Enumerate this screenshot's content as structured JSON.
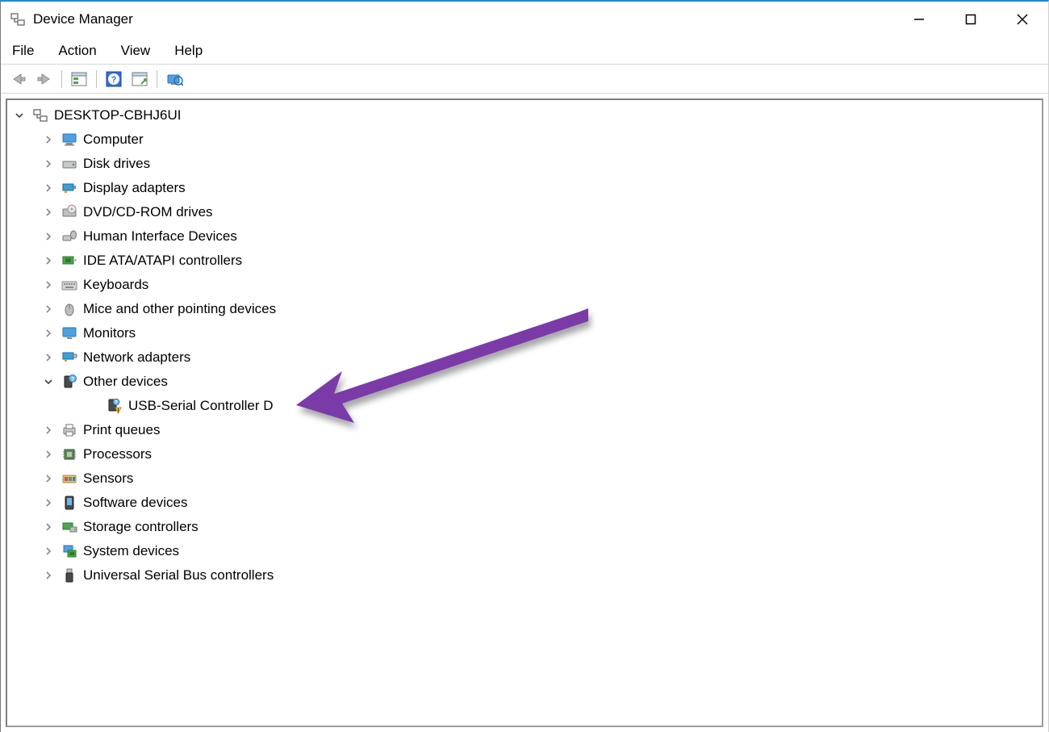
{
  "window": {
    "title": "Device Manager"
  },
  "menu": {
    "file": "File",
    "action": "Action",
    "view": "View",
    "help": "Help"
  },
  "toolbar": {
    "back": "back",
    "forward": "forward",
    "show_hidden": "show-hidden",
    "help": "help",
    "properties": "properties",
    "scan": "scan"
  },
  "tree": {
    "root": "DESKTOP-CBHJ6UI",
    "items": [
      {
        "label": "Computer",
        "icon": "computer",
        "expanded": false
      },
      {
        "label": "Disk drives",
        "icon": "disk",
        "expanded": false
      },
      {
        "label": "Display adapters",
        "icon": "display",
        "expanded": false
      },
      {
        "label": "DVD/CD-ROM drives",
        "icon": "dvd",
        "expanded": false
      },
      {
        "label": "Human Interface Devices",
        "icon": "hid",
        "expanded": false
      },
      {
        "label": "IDE ATA/ATAPI controllers",
        "icon": "ide",
        "expanded": false
      },
      {
        "label": "Keyboards",
        "icon": "keyboard",
        "expanded": false
      },
      {
        "label": "Mice and other pointing devices",
        "icon": "mouse",
        "expanded": false
      },
      {
        "label": "Monitors",
        "icon": "monitor",
        "expanded": false
      },
      {
        "label": "Network adapters",
        "icon": "network",
        "expanded": false
      },
      {
        "label": "Other devices",
        "icon": "other",
        "expanded": true,
        "children": [
          {
            "label": "USB-Serial Controller D",
            "icon": "warning-device"
          }
        ]
      },
      {
        "label": "Print queues",
        "icon": "printer",
        "expanded": false
      },
      {
        "label": "Processors",
        "icon": "processor",
        "expanded": false
      },
      {
        "label": "Sensors",
        "icon": "sensor",
        "expanded": false
      },
      {
        "label": "Software devices",
        "icon": "software",
        "expanded": false
      },
      {
        "label": "Storage controllers",
        "icon": "storage",
        "expanded": false
      },
      {
        "label": "System devices",
        "icon": "system",
        "expanded": false
      },
      {
        "label": "Universal Serial Bus controllers",
        "icon": "usb",
        "expanded": false
      }
    ]
  },
  "annotation": {
    "arrow_color": "#7a3aa8",
    "target": "USB-Serial Controller D"
  }
}
